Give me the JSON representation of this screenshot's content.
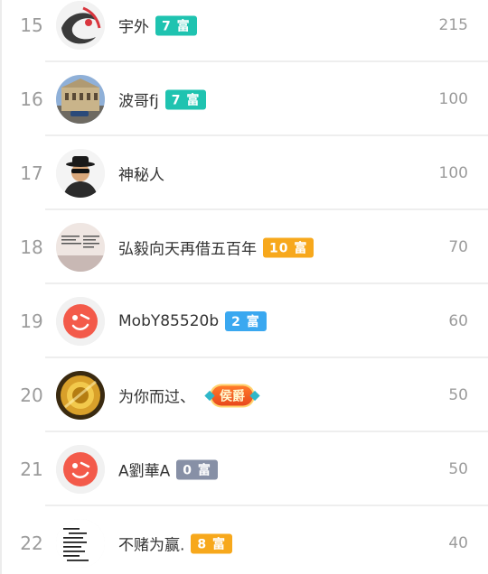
{
  "colors": {
    "badge_teal": "#1fc3b0",
    "badge_orange": "#f7a81c",
    "badge_blue": "#3aa8f0",
    "badge_gray": "#8790a6",
    "rank_text": "#9c9c9c",
    "name_text": "#333333"
  },
  "rows": [
    {
      "rank": "15",
      "name": "宇外",
      "badge": "7 富",
      "badge_color": "teal",
      "score": "215",
      "avatar": "ink-swirl-avatar"
    },
    {
      "rank": "16",
      "name": "波哥fj",
      "badge": "7 富",
      "badge_color": "teal",
      "score": "100",
      "avatar": "building-avatar"
    },
    {
      "rank": "17",
      "name": "神秘人",
      "badge": "",
      "badge_color": "",
      "score": "100",
      "avatar": "mystery-man-avatar"
    },
    {
      "rank": "18",
      "name": "弘毅向天再借五百年",
      "badge": "10 富",
      "badge_color": "orange",
      "score": "70",
      "avatar": "text-image-avatar"
    },
    {
      "rank": "19",
      "name": "MobY85520b",
      "badge": "2 富",
      "badge_color": "blue",
      "score": "60",
      "avatar": "weibo-default-avatar"
    },
    {
      "rank": "20",
      "name": "为你而过、",
      "badge": "",
      "badge_color": "",
      "title_badge": "侯爵",
      "score": "50",
      "avatar": "gold-coin-avatar"
    },
    {
      "rank": "21",
      "name": "A劉華A",
      "badge": "0 富",
      "badge_color": "gray",
      "score": "50",
      "avatar": "weibo-default-avatar"
    },
    {
      "rank": "22",
      "name": "不赌为赢.",
      "badge": "8 富",
      "badge_color": "orange",
      "score": "40",
      "avatar": "text-note-avatar"
    }
  ]
}
